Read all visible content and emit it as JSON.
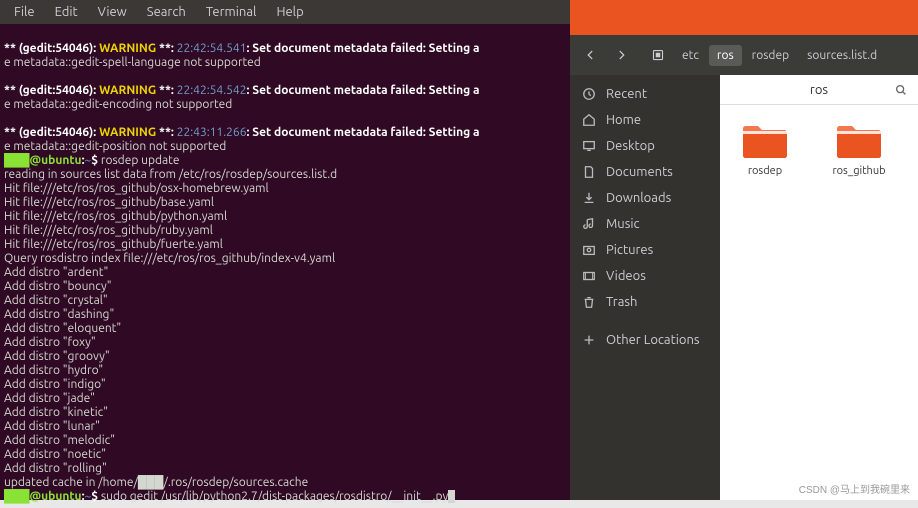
{
  "terminal": {
    "menu": [
      "File",
      "Edit",
      "View",
      "Search",
      "Terminal",
      "Help"
    ],
    "w1_prefix": "** (gedit:54046): ",
    "warn": "WARNING",
    "w1_mid": " **: ",
    "t1": "22:42:54.541",
    "w1_suf": ": Set document metadata failed: Setting a",
    "l1b": "e metadata::gedit-spell-language not supported",
    "t2": "22:42:54.542",
    "l2b": "e metadata::gedit-encoding not supported",
    "t3": "22:43:11.266",
    "l3b": "e metadata::gedit-position not supported",
    "host": "@ubuntu",
    "colon": ":",
    "tilde": "~",
    "dollar": "$ ",
    "cmd1": "rosdep update",
    "r1": "reading in sources list data from /etc/ros/rosdep/sources.list.d",
    "r2": "Hit file:///etc/ros/ros_github/osx-homebrew.yaml",
    "r3": "Hit file:///etc/ros/ros_github/base.yaml",
    "r4": "Hit file:///etc/ros/ros_github/python.yaml",
    "r5": "Hit file:///etc/ros/ros_github/ruby.yaml",
    "r6": "Hit file:///etc/ros/ros_github/fuerte.yaml",
    "r7": "Query rosdistro index file:///etc/ros/ros_github/index-v4.yaml",
    "d1": "Add distro \"ardent\"",
    "d2": "Add distro \"bouncy\"",
    "d3": "Add distro \"crystal\"",
    "d4": "Add distro \"dashing\"",
    "d5": "Add distro \"eloquent\"",
    "d6": "Add distro \"foxy\"",
    "d7": "Add distro \"groovy\"",
    "d8": "Add distro \"hydro\"",
    "d9": "Add distro \"indigo\"",
    "d10": "Add distro \"jade\"",
    "d11": "Add distro \"kinetic\"",
    "d12": "Add distro \"lunar\"",
    "d13": "Add distro \"melodic\"",
    "d14": "Add distro \"noetic\"",
    "d15": "Add distro \"rolling\"",
    "cache_a": "updated cache in /home/",
    "cache_b": "/.ros/rosdep/sources.cache",
    "cmd2": "sudo gedit /usr/lib/python2.7/dist-packages/rosdistro/__init__.py"
  },
  "nautilus": {
    "path": [
      "etc",
      "ros",
      "rosdep",
      "sources.list.d"
    ],
    "active_path_idx": 1,
    "title": "ros",
    "sidebar": [
      {
        "icon": "clock",
        "label": "Recent"
      },
      {
        "icon": "home",
        "label": "Home"
      },
      {
        "icon": "desktop",
        "label": "Desktop"
      },
      {
        "icon": "docs",
        "label": "Documents"
      },
      {
        "icon": "down",
        "label": "Downloads"
      },
      {
        "icon": "music",
        "label": "Music"
      },
      {
        "icon": "pics",
        "label": "Pictures"
      },
      {
        "icon": "video",
        "label": "Videos"
      },
      {
        "icon": "trash",
        "label": "Trash"
      },
      {
        "icon": "plus",
        "label": "Other Locations"
      }
    ],
    "files": [
      {
        "name": "rosdep"
      },
      {
        "name": "ros_github"
      }
    ]
  },
  "watermark": "CSDN @马上到我碗里来"
}
